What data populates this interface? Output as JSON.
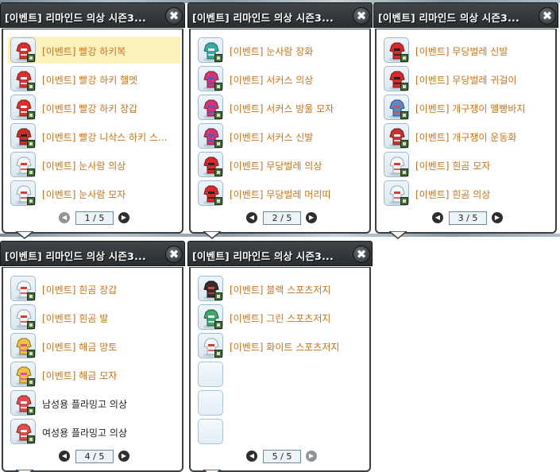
{
  "windows": [
    {
      "title": "[이벤트] 리마인드 의상 시즌3...",
      "close_glyph": "✖",
      "page": "1 / 5",
      "prev_glyph": "◀",
      "next_glyph": "▶",
      "items": [
        {
          "label": "[이벤트] 빨강 하키복",
          "icon": "red-hockey-jersey-icon",
          "selected": true,
          "style": "orange"
        },
        {
          "label": "[이벤트] 빨강 하키 헬멧",
          "icon": "red-hockey-helmet-icon",
          "style": "orange"
        },
        {
          "label": "[이벤트] 빨강 하키 장갑",
          "icon": "red-hockey-gloves-icon",
          "style": "orange"
        },
        {
          "label": "[이벤트] 빨강 니삭스 하키 스...",
          "icon": "red-hockey-skates-icon",
          "style": "orange"
        },
        {
          "label": "[이벤트] 눈사람 의상",
          "icon": "snowman-outfit-icon",
          "style": "orange"
        },
        {
          "label": "[이벤트] 눈사람 모자",
          "icon": "snowman-hat-icon",
          "style": "orange"
        }
      ]
    },
    {
      "title": "[이벤트] 리마인드 의상 시즌3...",
      "close_glyph": "✖",
      "page": "2 / 5",
      "prev_glyph": "◀",
      "next_glyph": "▶",
      "items": [
        {
          "label": "[이벤트] 눈사람 장화",
          "icon": "snowman-boots-icon",
          "style": "orange"
        },
        {
          "label": "[이벤트] 서커스 의상",
          "icon": "circus-outfit-icon",
          "style": "orange"
        },
        {
          "label": "[이벤트] 서커스 방울 모자",
          "icon": "circus-bell-hat-icon",
          "style": "orange"
        },
        {
          "label": "[이벤트] 서커스 신발",
          "icon": "circus-shoes-icon",
          "style": "orange"
        },
        {
          "label": "[이벤트] 무당벌레 의상",
          "icon": "ladybug-outfit-icon",
          "style": "orange"
        },
        {
          "label": "[이벤트] 무당벌레 머리띠",
          "icon": "ladybug-headband-icon",
          "style": "orange"
        }
      ]
    },
    {
      "title": "[이벤트] 리마인드 의상 시즌3...",
      "close_glyph": "✖",
      "page": "3 / 5",
      "prev_glyph": "◀",
      "next_glyph": "▶",
      "items": [
        {
          "label": "[이벤트] 무당벌레 신발",
          "icon": "ladybug-shoes-icon",
          "style": "orange"
        },
        {
          "label": "[이벤트] 무당벌레 귀걸이",
          "icon": "ladybug-earrings-icon",
          "style": "orange"
        },
        {
          "label": "[이벤트] 개구쟁이 멜빵바지",
          "icon": "overalls-icon",
          "style": "orange"
        },
        {
          "label": "[이벤트] 개구쟁이 운동화",
          "icon": "sneakers-icon",
          "style": "orange"
        },
        {
          "label": "[이벤트] 흰곰 모자",
          "icon": "polar-bear-hat-icon",
          "style": "orange"
        },
        {
          "label": "[이벤트] 흰곰 의상",
          "icon": "polar-bear-outfit-icon",
          "style": "orange"
        }
      ]
    },
    {
      "title": "[이벤트] 리마인드 의상 시즌3...",
      "close_glyph": "✖",
      "page": "4 / 5",
      "prev_glyph": "◀",
      "next_glyph": "▶",
      "items": [
        {
          "label": "[이벤트] 흰곰 장갑",
          "icon": "polar-bear-gloves-icon",
          "style": "orange"
        },
        {
          "label": "[이벤트] 흰곰 발",
          "icon": "polar-bear-feet-icon",
          "style": "orange"
        },
        {
          "label": "[이벤트] 해금 망토",
          "icon": "haegeum-cape-icon",
          "style": "orange"
        },
        {
          "label": "[이벤트] 해금 모자",
          "icon": "haegeum-hat-icon",
          "style": "orange"
        },
        {
          "label": "남성용 플라밍고 의상",
          "icon": "flamingo-outfit-male-icon",
          "style": "black"
        },
        {
          "label": "여성용 플라밍고 의상",
          "icon": "flamingo-outfit-female-icon",
          "style": "black"
        }
      ]
    },
    {
      "title": "[이벤트] 리마인드 의상 시즌3...",
      "close_glyph": "✖",
      "page": "5 / 5",
      "prev_glyph": "◀",
      "next_glyph": "▶",
      "items": [
        {
          "label": "[이벤트] 블랙 스포츠저지",
          "icon": "black-sports-jersey-icon",
          "style": "orange"
        },
        {
          "label": "[이벤트] 그린 스포츠저지",
          "icon": "green-sports-jersey-icon",
          "style": "orange"
        },
        {
          "label": "[이벤트] 화이트 스포츠저지",
          "icon": "white-sports-jersey-icon",
          "style": "orange"
        },
        {
          "label": "",
          "icon": "empty-slot",
          "empty": true
        },
        {
          "label": "",
          "icon": "empty-slot",
          "empty": true
        },
        {
          "label": "",
          "icon": "empty-slot",
          "empty": true
        }
      ]
    }
  ]
}
